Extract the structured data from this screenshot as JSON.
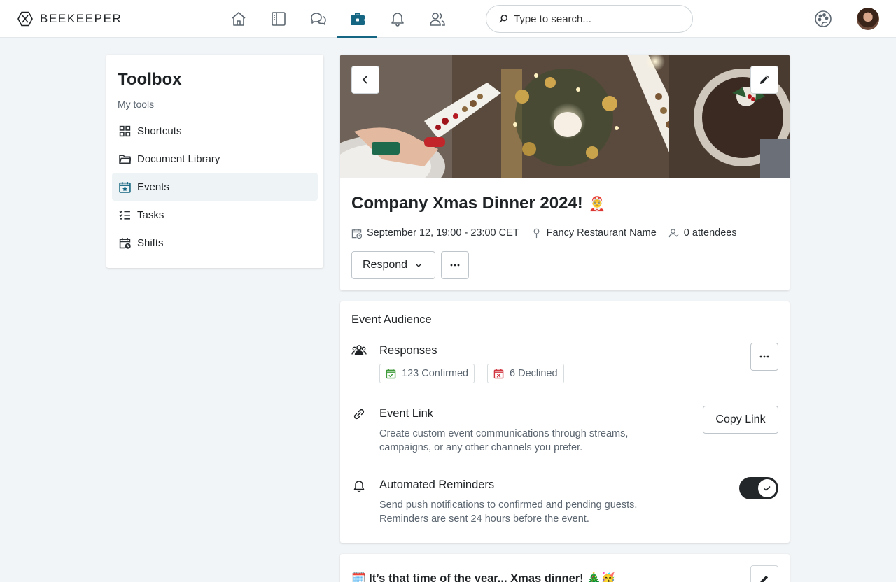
{
  "app": {
    "brand": "BEEKEEPER"
  },
  "nav": {
    "items": [
      {
        "icon": "home-icon"
      },
      {
        "icon": "book-icon"
      },
      {
        "icon": "chat-icon"
      },
      {
        "icon": "toolbox-icon",
        "active": true
      },
      {
        "icon": "bell-icon"
      },
      {
        "icon": "people-icon"
      }
    ],
    "active_color": "#156682"
  },
  "search": {
    "placeholder": "Type to search..."
  },
  "toolbox": {
    "title": "Toolbox",
    "subtitle": "My tools",
    "items": [
      {
        "label": "Shortcuts",
        "icon": "grid-icon"
      },
      {
        "label": "Document Library",
        "icon": "folder-icon"
      },
      {
        "label": "Events",
        "icon": "calendar-star-icon",
        "active": true
      },
      {
        "label": "Tasks",
        "icon": "checklist-icon"
      },
      {
        "label": "Shifts",
        "icon": "calendar-clock-icon"
      }
    ]
  },
  "event": {
    "title": "Company Xmas Dinner 2024!",
    "title_emoji": "🤶",
    "datetime": "September 12, 19:00 - 23:00 CET",
    "location": "Fancy Restaurant Name",
    "attendees": "0 attendees",
    "respond_label": "Respond",
    "more_label": "···"
  },
  "audience": {
    "title": "Event Audience",
    "responses": {
      "title": "Responses",
      "confirmed": "123 Confirmed",
      "declined": "6 Declined",
      "confirmed_color": "#3f9b3a",
      "declined_color": "#d0353f"
    },
    "link": {
      "title": "Event Link",
      "desc_line1": "Create custom event communications through streams,",
      "desc_line2": "campaigns, or any other channels you prefer.",
      "button": "Copy Link"
    },
    "reminders": {
      "title": "Automated Reminders",
      "desc_line1": "Send push notifications to confirmed and pending guests.",
      "desc_line2": "Reminders are sent 24 hours before the event.",
      "enabled": true
    }
  },
  "post": {
    "title": "🗓️ It’s that time of the year... Xmas dinner! 🎄🥳"
  }
}
